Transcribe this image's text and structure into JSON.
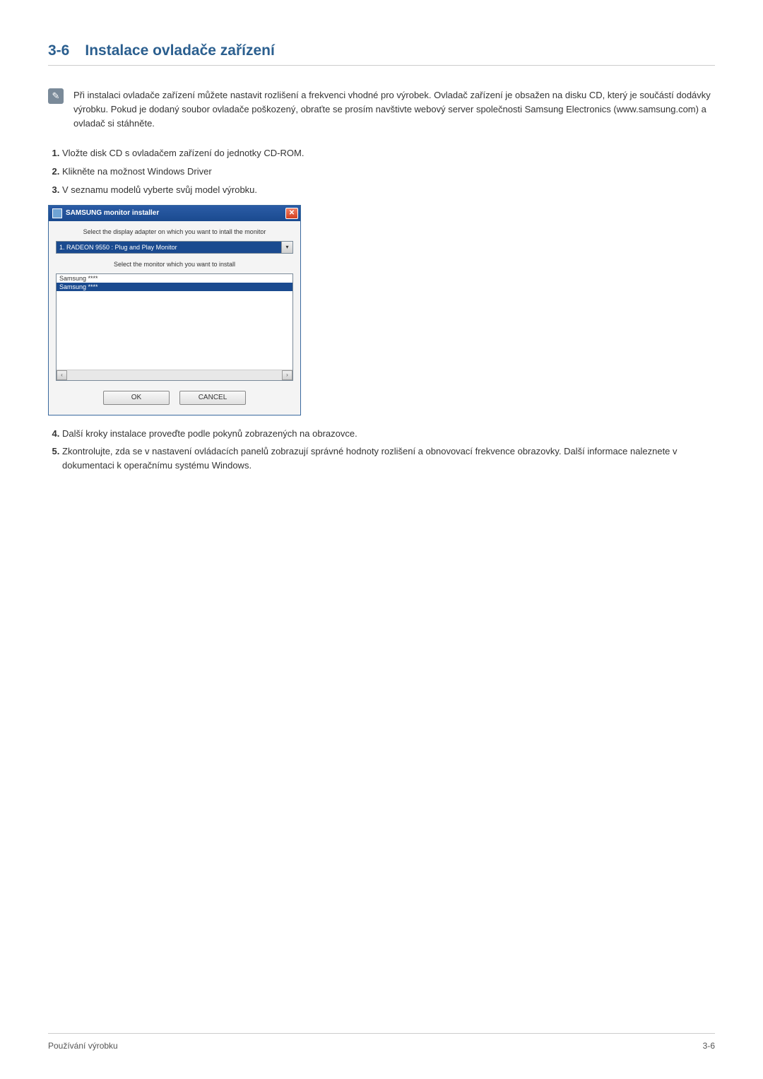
{
  "section": {
    "number": "3-6",
    "title": "Instalace ovladače zařízení"
  },
  "note": {
    "icon_symbol": "✎",
    "text": "Při instalaci ovladače zařízení můžete nastavit rozlišení a frekvenci vhodné pro výrobek. Ovladač zařízení je obsažen na disku CD, který je součástí dodávky výrobku. Pokud je dodaný soubor ovladače poškozený, obraťte se prosím navštivte webový server společnosti Samsung Electronics (www.samsung.com) a ovladač si stáhněte."
  },
  "steps_before": [
    "Vložte disk CD s ovladačem zařízení do jednotky CD-ROM.",
    "Klikněte na možnost Windows Driver",
    "V seznamu modelů vyberte svůj model výrobku."
  ],
  "installer": {
    "title": "SAMSUNG monitor installer",
    "label1": "Select the display adapter on which you want to intall the monitor",
    "dropdown_value": "1. RADEON 9550 : Plug and Play Monitor",
    "label2": "Select the monitor which you want to install",
    "list_items": [
      "Samsung ****",
      "Samsung ****"
    ],
    "ok_label": "OK",
    "cancel_label": "CANCEL",
    "close_symbol": "✕",
    "dropdown_arrow": "▾",
    "scroll_left": "‹",
    "scroll_right": "›"
  },
  "steps_after": [
    "Další kroky instalace proveďte podle pokynů zobrazených na obrazovce.",
    "Zkontrolujte, zda se v nastavení ovládacích panelů zobrazují správné hodnoty rozlišení a obnovovací frekvence obrazovky. Další informace naleznete v dokumentaci k operačnímu systému Windows."
  ],
  "footer": {
    "left": "Používání výrobku",
    "right": "3-6"
  }
}
